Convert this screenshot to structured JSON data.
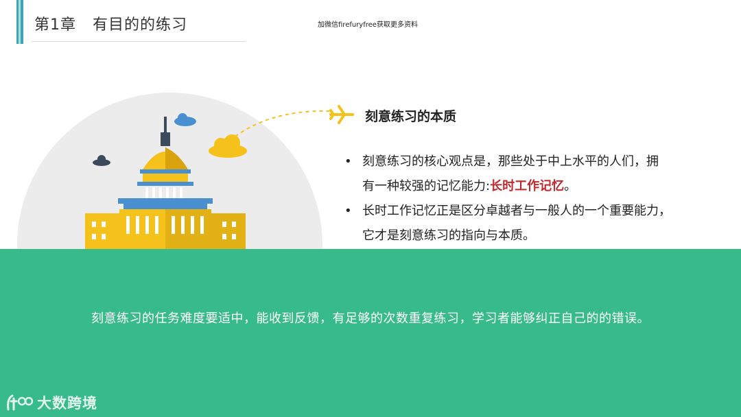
{
  "header": {
    "chapter_title": "第1章   有目的的练习",
    "watermark": "加微信firefuryfree获取更多资料"
  },
  "section": {
    "heading": "刻意练习的本质",
    "bullet1_line1": "刻意练习的核心观点是，那些处于中上水平的人们，拥",
    "bullet1_line2_pre": "有一种较强的记忆能力:",
    "bullet1_highlight": "长时工作记忆",
    "bullet1_line2_post": "。",
    "bullet2_line1": "长时工作记忆正是区分卓越者与一般人的一个重要能力，",
    "bullet2_line2": "它才是刻意练习的指向与本质。"
  },
  "band": {
    "text": "刻意练习的任务难度要适中，能收到反馈，有足够的次数重复练习，学习者能够纠正自己的的错误。"
  },
  "logo": {
    "text": "大数跨境"
  },
  "colors": {
    "accent": "#3aa7b5",
    "band": "#37bb8a",
    "highlight": "#c0282d",
    "building_yellow": "#f5c21b",
    "building_blue": "#4a8fd0"
  }
}
